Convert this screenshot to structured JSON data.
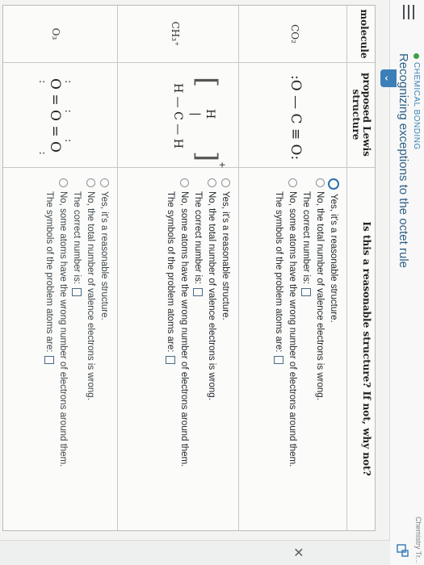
{
  "header": {
    "breadcrumb": "CHEMICAL BONDING",
    "title": "Recognizing exceptions to the octet rule",
    "top_right": "Chemistry Tr..."
  },
  "table": {
    "col_molecule": "molecule",
    "col_lewis": "proposed Lewis structure",
    "col_question": "Is this a reasonable structure? If not, why not?"
  },
  "options": {
    "yes": "Yes, it's a reasonable structure.",
    "valence_wrong": "No, the total number of valence electrons is wrong.",
    "correct_number": "The correct number is:",
    "atoms_wrong": "No, some atoms have the wrong number of electrons around them.",
    "symbols": "The symbols of the problem atoms are:"
  },
  "rows": [
    {
      "molecule": "CO₂",
      "lewis": ":O — C ≡ O:",
      "selected": "yes"
    },
    {
      "molecule": "CH₃⁺",
      "lewis_top": "H",
      "lewis_mid": "H — C — H",
      "charge": "+",
      "selected": "none"
    },
    {
      "molecule": "O₃",
      "lewis": "O = O = O",
      "selected": "none"
    }
  ]
}
